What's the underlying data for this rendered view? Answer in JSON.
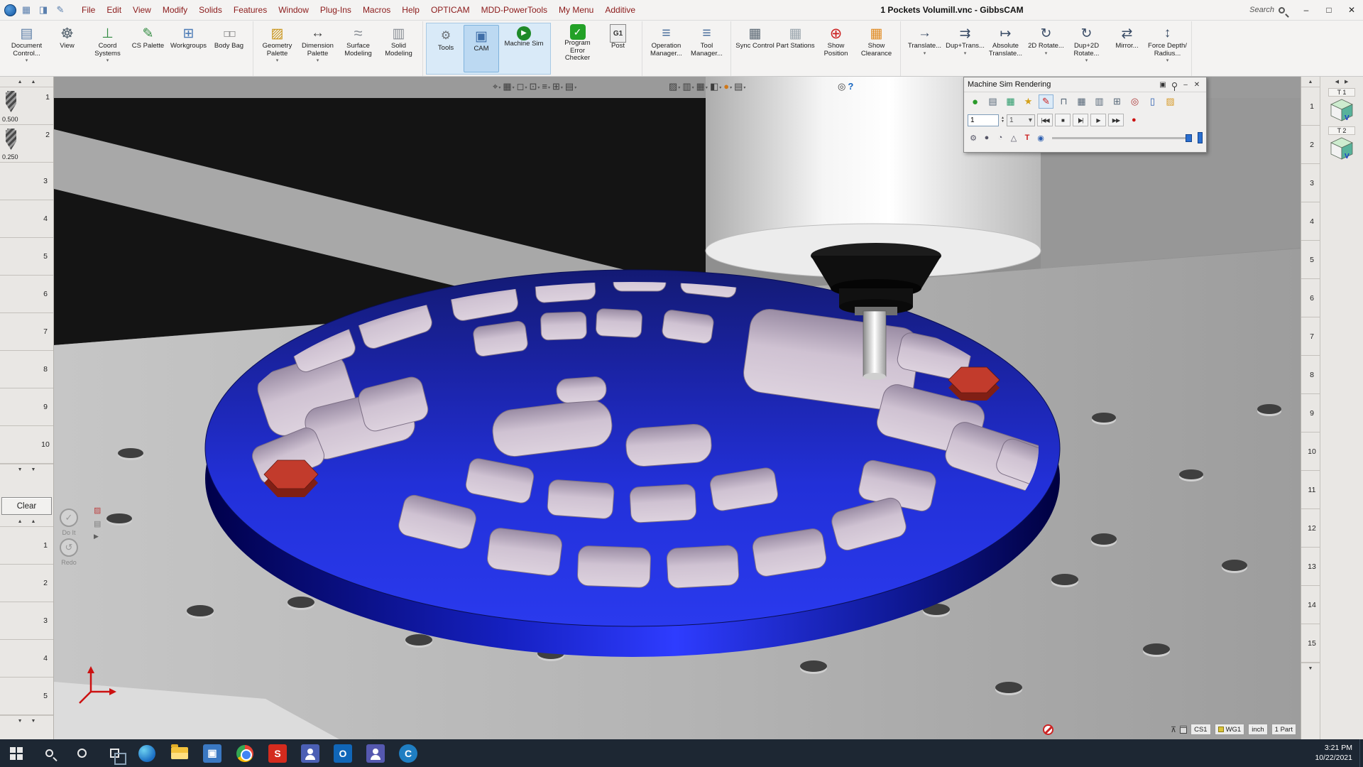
{
  "titlebar": {
    "title": "1 Pockets Volumill.vnc - GibbsCAM",
    "search": "Search"
  },
  "menus": [
    "File",
    "Edit",
    "View",
    "Modify",
    "Solids",
    "Features",
    "Window",
    "Plug-Ins",
    "Macros",
    "Help",
    "OPTICAM",
    "MDD-PowerTools",
    "My Menu",
    "Additive"
  ],
  "ribbon": {
    "group1": [
      {
        "label": "Document Control...",
        "icon": "▤",
        "icon_name": "document-control-icon",
        "caret": "▾"
      },
      {
        "label": "View",
        "icon": "☸",
        "icon_name": "view-wheel-icon",
        "caret": ""
      },
      {
        "label": "Coord Systems",
        "icon": "⊥",
        "icon_name": "coord-systems-icon",
        "caret": "▾"
      },
      {
        "label": "CS Palette",
        "icon": "✎",
        "icon_name": "cs-palette-icon",
        "caret": ""
      },
      {
        "label": "Workgroups",
        "icon": "⊞",
        "icon_name": "workgroups-icon",
        "caret": ""
      },
      {
        "label": "Body Bag",
        "icon": "◻◻",
        "icon_name": "body-bag-icon",
        "caret": ""
      }
    ],
    "group2": [
      {
        "label": "Geometry Palette",
        "icon": "▨",
        "icon_name": "geometry-palette-icon",
        "caret": "▾"
      },
      {
        "label": "Dimension Palette",
        "icon": "↔",
        "icon_name": "dimension-palette-icon",
        "caret": "▾"
      },
      {
        "label": "Surface Modeling",
        "icon": "≈",
        "icon_name": "surface-modeling-icon",
        "caret": ""
      },
      {
        "label": "Solid Modeling",
        "icon": "▥",
        "icon_name": "solid-modeling-icon",
        "caret": ""
      }
    ],
    "group3": [
      {
        "label": "Tools",
        "icon": "⚙",
        "icon_name": "tools-icon",
        "caret": ""
      },
      {
        "label": "CAM",
        "icon": "▣",
        "icon_name": "cam-icon",
        "caret": ""
      },
      {
        "label": "Machine Sim",
        "icon": "▶",
        "icon_name": "machine-sim-icon",
        "caret": ""
      }
    ],
    "group3b": [
      {
        "label": "Program Error Checker",
        "icon": "✓",
        "icon_name": "program-error-checker-icon",
        "caret": ""
      },
      {
        "label": "Post",
        "icon": "G1",
        "icon_name": "post-icon",
        "caret": ""
      }
    ],
    "group4": [
      {
        "label": "Operation Manager...",
        "icon": "≡",
        "icon_name": "operation-manager-icon",
        "caret": ""
      },
      {
        "label": "Tool Manager...",
        "icon": "≡",
        "icon_name": "tool-manager-icon",
        "caret": ""
      }
    ],
    "group5": [
      {
        "label": "Sync Control",
        "icon": "▦",
        "icon_name": "sync-control-icon",
        "caret": ""
      },
      {
        "label": "Part Stations",
        "icon": "▦",
        "icon_name": "part-stations-icon",
        "caret": ""
      },
      {
        "label": "Show Position",
        "icon": "⊕",
        "icon_name": "show-position-icon",
        "caret": ""
      },
      {
        "label": "Show Clearance",
        "icon": "▦",
        "icon_name": "show-clearance-icon",
        "caret": ""
      }
    ],
    "group6": [
      {
        "label": "Translate...",
        "icon": "→",
        "icon_name": "translate-icon",
        "caret": "▾"
      },
      {
        "label": "Dup+Trans...",
        "icon": "⇉",
        "icon_name": "dup-trans-icon",
        "caret": "▾"
      },
      {
        "label": "Absolute Translate...",
        "icon": "↦",
        "icon_name": "absolute-translate-icon",
        "caret": ""
      },
      {
        "label": "2D Rotate...",
        "icon": "↻",
        "icon_name": "rotate-2d-icon",
        "caret": "▾"
      },
      {
        "label": "Dup+2D Rotate...",
        "icon": "↻",
        "icon_name": "dup-2d-rotate-icon",
        "caret": "▾"
      },
      {
        "label": "Mirror...",
        "icon": "⇄",
        "icon_name": "mirror-icon",
        "caret": ""
      },
      {
        "label": "Force Depth/ Radius...",
        "icon": "↕",
        "icon_name": "force-depth-radius-icon",
        "caret": "▾"
      }
    ]
  },
  "tool_list": {
    "tools": [
      {
        "number": "1",
        "size": "0.500"
      },
      {
        "number": "2",
        "size": "0.250"
      }
    ],
    "numbers": [
      "3",
      "4",
      "5",
      "6",
      "7",
      "8",
      "9",
      "10"
    ]
  },
  "lower_list": {
    "clear": "Clear",
    "numbers": [
      "1",
      "2",
      "3",
      "4",
      "5"
    ],
    "do_it": "Do It",
    "redo": "Redo"
  },
  "right_strip": {
    "numbers": [
      "1",
      "2",
      "3",
      "4",
      "5",
      "6",
      "7",
      "8",
      "9",
      "10",
      "11",
      "12",
      "13",
      "14",
      "15"
    ]
  },
  "right_tools": [
    {
      "label": "T 1"
    },
    {
      "label": "T 2"
    }
  ],
  "vp_tools_a": [
    {
      "glyph": "⌖",
      "name": "select-tool-icon"
    },
    {
      "glyph": "▦",
      "name": "grid-snap-icon"
    },
    {
      "glyph": "◻",
      "name": "box-select-icon"
    },
    {
      "glyph": "⊡",
      "name": "center-select-icon"
    },
    {
      "glyph": "≡",
      "name": "list-filter-icon"
    },
    {
      "glyph": "⊞",
      "name": "add-view-icon"
    },
    {
      "glyph": "▤",
      "name": "layers-filter-icon"
    }
  ],
  "vp_tools_b": [
    {
      "glyph": "▨",
      "name": "shade-mode-icon"
    },
    {
      "glyph": "▥",
      "name": "wireframe-icon"
    },
    {
      "glyph": "▦",
      "name": "table-view-icon"
    },
    {
      "glyph": "◧",
      "name": "half-view-icon"
    },
    {
      "glyph": "●",
      "name": "render-sphere-icon"
    },
    {
      "glyph": "▤",
      "name": "print-view-icon"
    }
  ],
  "vp_tools_c": [
    {
      "glyph": "◎",
      "name": "zoom-tool-icon"
    },
    {
      "glyph": "?",
      "name": "help-icon"
    }
  ],
  "sim_palette": {
    "title": "Machine Sim Rendering",
    "speed": "1",
    "stage": "1",
    "row1": [
      {
        "glyph": "●",
        "name": "stock-render-icon"
      },
      {
        "glyph": "▤",
        "name": "layers-icon"
      },
      {
        "glyph": "▦",
        "name": "compare-icon"
      },
      {
        "glyph": "★",
        "name": "sparks-icon"
      },
      {
        "glyph": "✎",
        "name": "paint-toolpath-icon"
      },
      {
        "glyph": "⊓",
        "name": "lock-icon"
      },
      {
        "glyph": "▦",
        "name": "grid-icon"
      },
      {
        "glyph": "▥",
        "name": "columns-icon"
      },
      {
        "glyph": "⊞",
        "name": "flowchart-icon"
      },
      {
        "glyph": "◎",
        "name": "find-icon"
      },
      {
        "glyph": "▯",
        "name": "report-icon"
      },
      {
        "glyph": "▨",
        "name": "open-folder-icon"
      }
    ],
    "row3": [
      {
        "glyph": "⚙",
        "name": "sim-settings-icon"
      },
      {
        "glyph": "●",
        "name": "dark-sphere-icon"
      },
      {
        "glyph": "◔",
        "name": "clock-icon"
      },
      {
        "glyph": "△",
        "name": "warning-icon"
      },
      {
        "glyph": "T",
        "name": "tool-text-icon"
      },
      {
        "glyph": "◉",
        "name": "eye-icon"
      }
    ]
  },
  "statusbar": {
    "cs": "CS1",
    "wg": "WG1",
    "units": "inch",
    "parts": "1 Part"
  },
  "taskbar": {
    "time": "3:21 PM",
    "date": "10/22/2021"
  },
  "icons": {
    "caret": "▾",
    "up": "▲",
    "down": "▼",
    "minimize": "–",
    "maximize": "□",
    "close": "✕",
    "dock": "▣",
    "skip_start": "|◀◀",
    "stop_btn": "■",
    "step_fwd": "|▶|",
    "play": "▶",
    "fast_fwd": "▶▶",
    "record": "●",
    "doit_glyph": "✓",
    "redo_glyph": "↺"
  }
}
